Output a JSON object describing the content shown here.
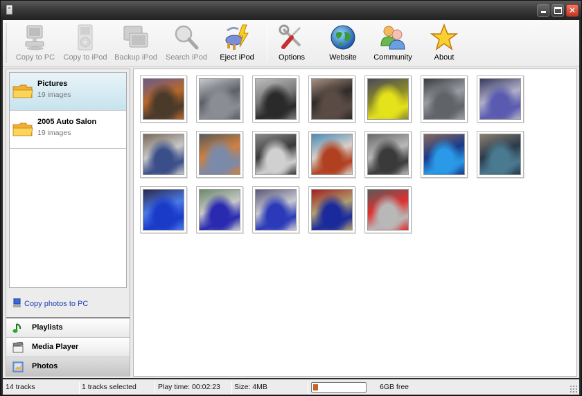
{
  "window": {
    "title": "",
    "controls": {
      "minimize": "minimize",
      "maximize": "maximize",
      "close": "close"
    }
  },
  "toolbar": {
    "buttons": [
      {
        "label": "Copy to PC",
        "icon": "computer-icon",
        "enabled": false
      },
      {
        "label": "Copy to iPod",
        "icon": "ipod-icon",
        "enabled": false
      },
      {
        "label": "Backup iPod",
        "icon": "backup-icon",
        "enabled": false
      },
      {
        "label": "Search iPod",
        "icon": "magnifier-icon",
        "enabled": false
      },
      {
        "label": "Eject iPod",
        "icon": "eject-plug-icon",
        "enabled": true
      },
      {
        "label": "Options",
        "icon": "wrench-screwdriver-icon",
        "enabled": true
      },
      {
        "label": "Website",
        "icon": "globe-icon",
        "enabled": true
      },
      {
        "label": "Community",
        "icon": "users-icon",
        "enabled": true
      },
      {
        "label": "About",
        "icon": "star-icon",
        "enabled": true
      }
    ]
  },
  "sidebar": {
    "albums": [
      {
        "name": "Pictures",
        "count": "19 images",
        "selected": true
      },
      {
        "name": "2005 Auto Salon",
        "count": "19 images",
        "selected": false
      }
    ],
    "copy_link": "Copy photos to PC",
    "nav": [
      {
        "label": "Playlists",
        "icon": "music-note-icon",
        "active": false
      },
      {
        "label": "Media Player",
        "icon": "clapperboard-icon",
        "active": false
      },
      {
        "label": "Photos",
        "icon": "photo-icon",
        "active": true
      }
    ]
  },
  "gallery": {
    "thumbnails": [
      {
        "subject": "orange car engine bay",
        "colors": [
          "#4a3a2a",
          "#b8682a",
          "#6a5a8a"
        ]
      },
      {
        "subject": "grey sedan",
        "colors": [
          "#8a8d94",
          "#5d6068",
          "#c8c8cc"
        ]
      },
      {
        "subject": "car audio speakers",
        "colors": [
          "#2a2a2a",
          "#7a7a7a",
          "#bdbdbd"
        ]
      },
      {
        "subject": "dark car hood open",
        "colors": [
          "#5a4c44",
          "#2f2a28",
          "#a89080"
        ]
      },
      {
        "subject": "yellow car",
        "colors": [
          "#e4e21a",
          "#8b8a2a",
          "#4a4a5a"
        ]
      },
      {
        "subject": "silver car front",
        "colors": [
          "#606468",
          "#9a9ea4",
          "#3a3c40"
        ]
      },
      {
        "subject": "engine chrome purple",
        "colors": [
          "#5a5ab0",
          "#b0b0c8",
          "#3a3a60"
        ]
      },
      {
        "subject": "exhibition hall",
        "colors": [
          "#3a4e8a",
          "#c8c8c8",
          "#7a6a5a"
        ]
      },
      {
        "subject": "exhibition crowd",
        "colors": [
          "#7a8aa8",
          "#d08040",
          "#5a5a5a"
        ]
      },
      {
        "subject": "white car hood open",
        "colors": [
          "#d0d0d0",
          "#3a3a3a",
          "#8a8a8a"
        ]
      },
      {
        "subject": "crowd red",
        "colors": [
          "#b04020",
          "#d8d0c8",
          "#4a8ab8"
        ]
      },
      {
        "subject": "car interior",
        "colors": [
          "#3a3a3a",
          "#b8b8b8",
          "#6a6a6a"
        ]
      },
      {
        "subject": "blue car",
        "colors": [
          "#2a9ae8",
          "#1a3a8a",
          "#8a6a5a"
        ]
      },
      {
        "subject": "teal car",
        "colors": [
          "#4a7a90",
          "#2a3a4a",
          "#8a8070"
        ]
      },
      {
        "subject": "blue car hood",
        "colors": [
          "#1a3ac8",
          "#4a7ae8",
          "#2a2a4a"
        ]
      },
      {
        "subject": "blue ute",
        "colors": [
          "#2a2ab0",
          "#c8c8c8",
          "#6a8a6a"
        ]
      },
      {
        "subject": "blue car engine",
        "colors": [
          "#2a3ab8",
          "#c8c8d0",
          "#5a5a7a"
        ]
      },
      {
        "subject": "blue car side",
        "colors": [
          "#1a2a9a",
          "#b0a070",
          "#a02020"
        ]
      },
      {
        "subject": "silver car red lights",
        "colors": [
          "#b8b8b8",
          "#e03030",
          "#5a5a5a"
        ]
      }
    ]
  },
  "statusbar": {
    "tracks": "14 tracks",
    "selected": "1 tracks selected",
    "play_time": "Play time: 00:02:23",
    "size": "Size: 4MB",
    "capacity_used_fraction": 0.12,
    "free": "6GB free"
  }
}
